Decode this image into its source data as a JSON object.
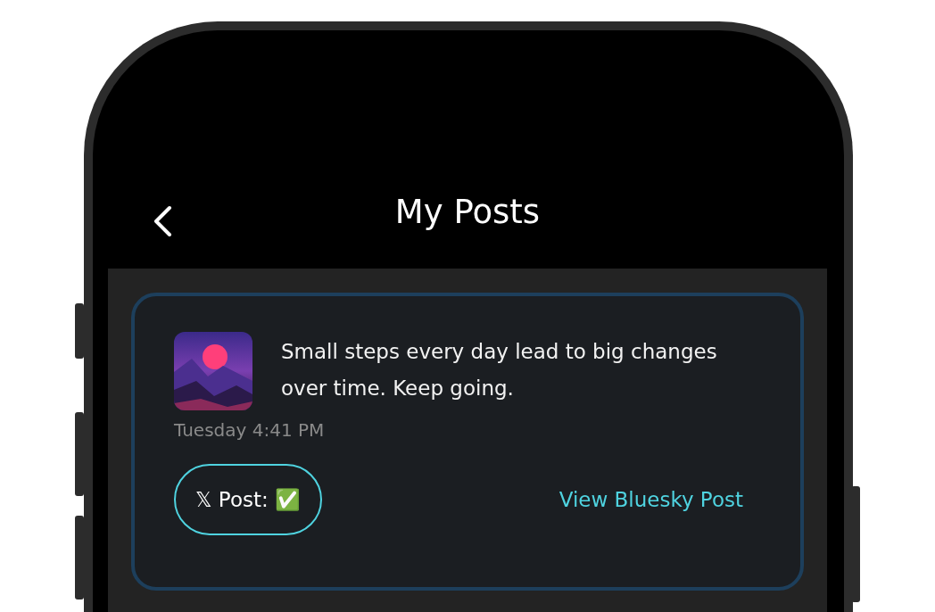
{
  "header": {
    "title": "My Posts"
  },
  "posts": [
    {
      "text": "Small steps every day lead to big changes over time. Keep going.",
      "timestamp": "Tuesday 4:41 PM",
      "x_status": "𝕏 Post: ✅",
      "link": "View Bluesky Post"
    }
  ]
}
